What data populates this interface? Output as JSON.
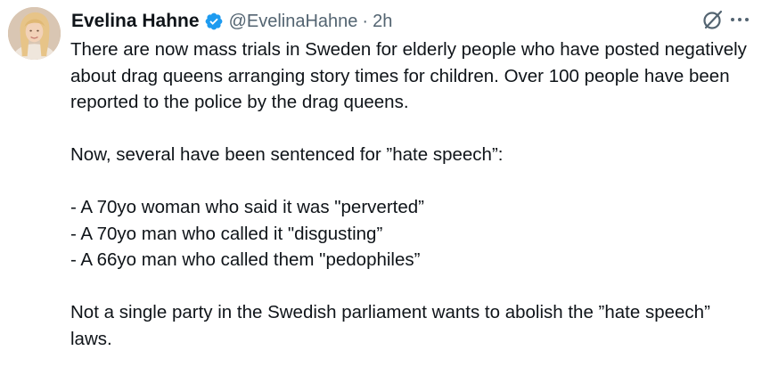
{
  "author": {
    "name": "Evelina Hahne",
    "handle": "@EvelinaHahne",
    "separator": "·",
    "time": "2h",
    "verified": true,
    "verified_color": "#1d9bf0"
  },
  "icons": {
    "avatar": "profile-photo",
    "verified": "verified-badge-icon",
    "grok": "grok-icon",
    "more": "more-icon"
  },
  "tweet": {
    "paragraph1": "There are now mass trials in Sweden for elderly people who have posted negatively about drag queens arranging story times for children. Over 100 people have been reported to the police by the drag queens.",
    "paragraph2": "Now, several have been sentenced for ”hate speech”:",
    "list": [
      "- A 70yo woman who said it was \"perverted”",
      "- A 70yo man who called it \"disgusting”",
      "- A 66yo man who called them \"pedophiles”"
    ],
    "paragraph3": "Not a single party in the Swedish parliament wants to abolish the ”hate speech” laws."
  }
}
